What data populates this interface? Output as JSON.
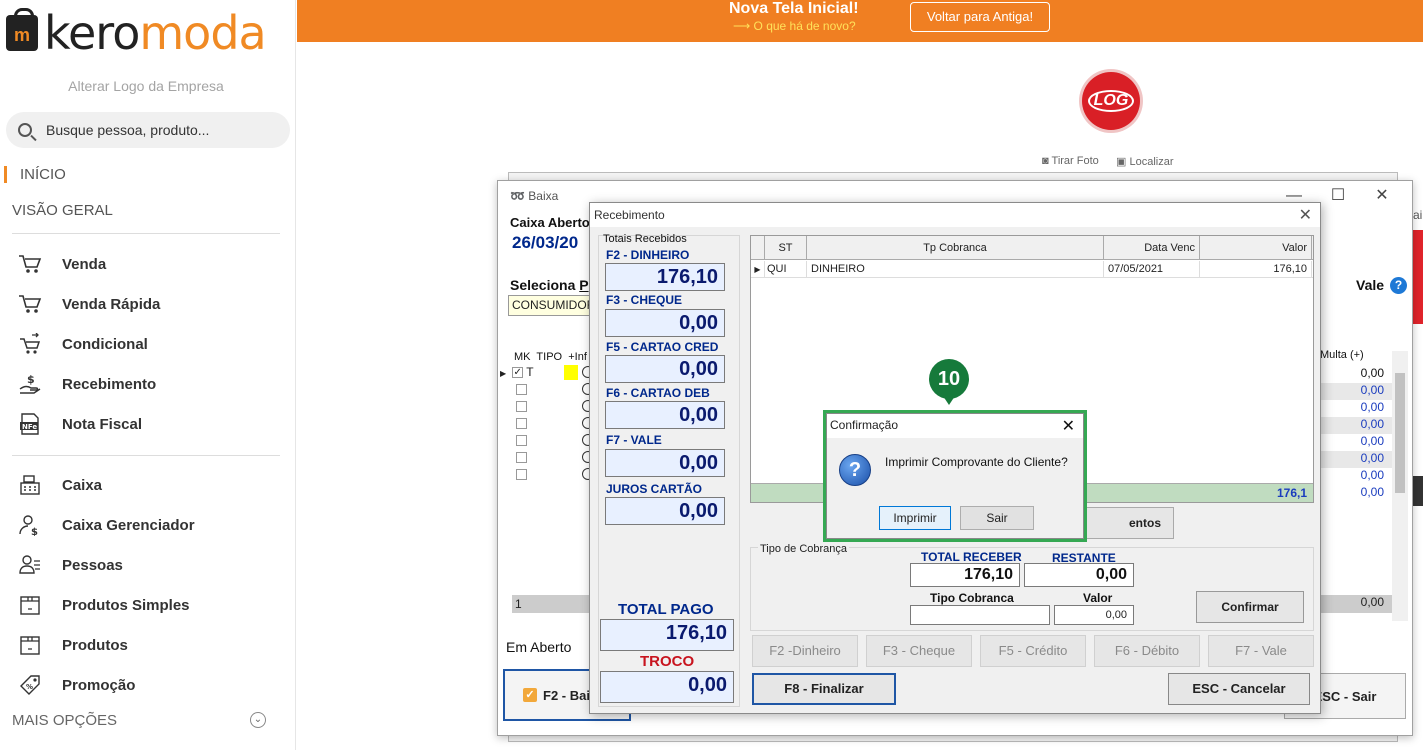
{
  "brand": {
    "logo_bag": "m",
    "logo_word1": "kero",
    "logo_word2": "moda",
    "alter_logo": "Alterar Logo da Empresa",
    "accent": "#f08a24"
  },
  "search": {
    "placeholder": "Busque pessoa, produto..."
  },
  "sidebar": {
    "inicio": "INÍCIO",
    "visao_geral": "VISÃO GERAL",
    "items": [
      {
        "label": "Venda",
        "icon": "cart-icon"
      },
      {
        "label": "Venda Rápida",
        "icon": "fast-cart-icon"
      },
      {
        "label": "Condicional",
        "icon": "cart-swap-icon"
      },
      {
        "label": "Recebimento",
        "icon": "money-hand-icon"
      },
      {
        "label": "Nota Fiscal",
        "icon": "nfe-icon"
      },
      {
        "label": "Caixa",
        "icon": "cash-register-icon"
      },
      {
        "label": "Caixa Gerenciador",
        "icon": "user-money-icon"
      },
      {
        "label": "Pessoas",
        "icon": "people-icon"
      },
      {
        "label": "Produtos Simples",
        "icon": "box-icon"
      },
      {
        "label": "Produtos",
        "icon": "box-icon"
      },
      {
        "label": "Promoção",
        "icon": "tag-icon"
      }
    ],
    "mais_opcoes": "MAIS OPÇÕES"
  },
  "banner": {
    "title": "Nova Tela Inicial!",
    "subtitle": "⟶ O que há de novo?",
    "button": "Voltar para Antiga!"
  },
  "company_logo": "LOG",
  "photo_links": {
    "tirar_foto": "Tirar Foto",
    "localizar": "Localizar"
  },
  "baixa": {
    "title": "Baixa",
    "caixa_aberto": "Caixa Aberto",
    "data": "26/03/20",
    "seleciona": "Seleciona",
    "seleciona_key": "P",
    "consumidor": "CONSUMIDOR",
    "vale": "Vale",
    "grid_head": {
      "mk": "MK",
      "tipo": "TIPO",
      "inf": "+Inf"
    },
    "first_row_tipo": "T",
    "multa_head": "Multa (+)",
    "multa_values": [
      "0,00",
      "0,00",
      "0,00",
      "0,00",
      "0,00",
      "0,00",
      "0,00",
      "0,00"
    ],
    "footer_count": "1",
    "footer_total": "0,00",
    "em_aberto": "Em Aberto",
    "f2_label": "F2 - Bai",
    "esc_sair": "ESC - Sair"
  },
  "recebimento": {
    "title": "Recebimento",
    "totais_label": "Totais Recebidos",
    "payments": [
      {
        "label": "F2 - DINHEIRO",
        "value": "176,10"
      },
      {
        "label": "F3 - CHEQUE",
        "value": "0,00"
      },
      {
        "label": "F5 - CARTAO CRED",
        "value": "0,00"
      },
      {
        "label": "F6 - CARTAO DEB",
        "value": "0,00"
      },
      {
        "label": "F7 - VALE",
        "value": "0,00"
      },
      {
        "label": "JUROS CARTÃO",
        "value": "0,00"
      }
    ],
    "total_pago_label": "TOTAL PAGO",
    "total_pago": "176,10",
    "troco_label": "TROCO",
    "troco": "0,00",
    "grid": {
      "headers": {
        "st": "ST",
        "tp": "Tp Cobranca",
        "venc": "Data Venc",
        "valor": "Valor"
      },
      "row": {
        "st": "QUI",
        "tp": "DINHEIRO",
        "venc": "07/05/2021",
        "valor": "176,10"
      },
      "footer_total": "176,1"
    },
    "lancamentos_btn": "entos",
    "tipo_cobranca_group": "Tipo de Cobrança",
    "total_receber_label": "TOTAL RECEBER",
    "total_receber": "176,10",
    "restante_label": "RESTANTE",
    "restante": "0,00",
    "tipo_cobranca_label": "Tipo Cobranca",
    "valor_label": "Valor",
    "valor_input": "0,00",
    "confirmar": "Confirmar",
    "fkeys": [
      "F2 -Dinheiro",
      "F3 - Cheque",
      "F5 - Crédito",
      "F6 - Débito",
      "F7 - Vale"
    ],
    "f8": "F8 - Finalizar",
    "esc_cancelar": "ESC - Cancelar"
  },
  "confirm": {
    "title": "Confirmação",
    "message": "Imprimir Comprovante do Cliente?",
    "imprimir": "Imprimir",
    "sair": "Sair",
    "step": "10"
  },
  "rhs_text": "ai"
}
